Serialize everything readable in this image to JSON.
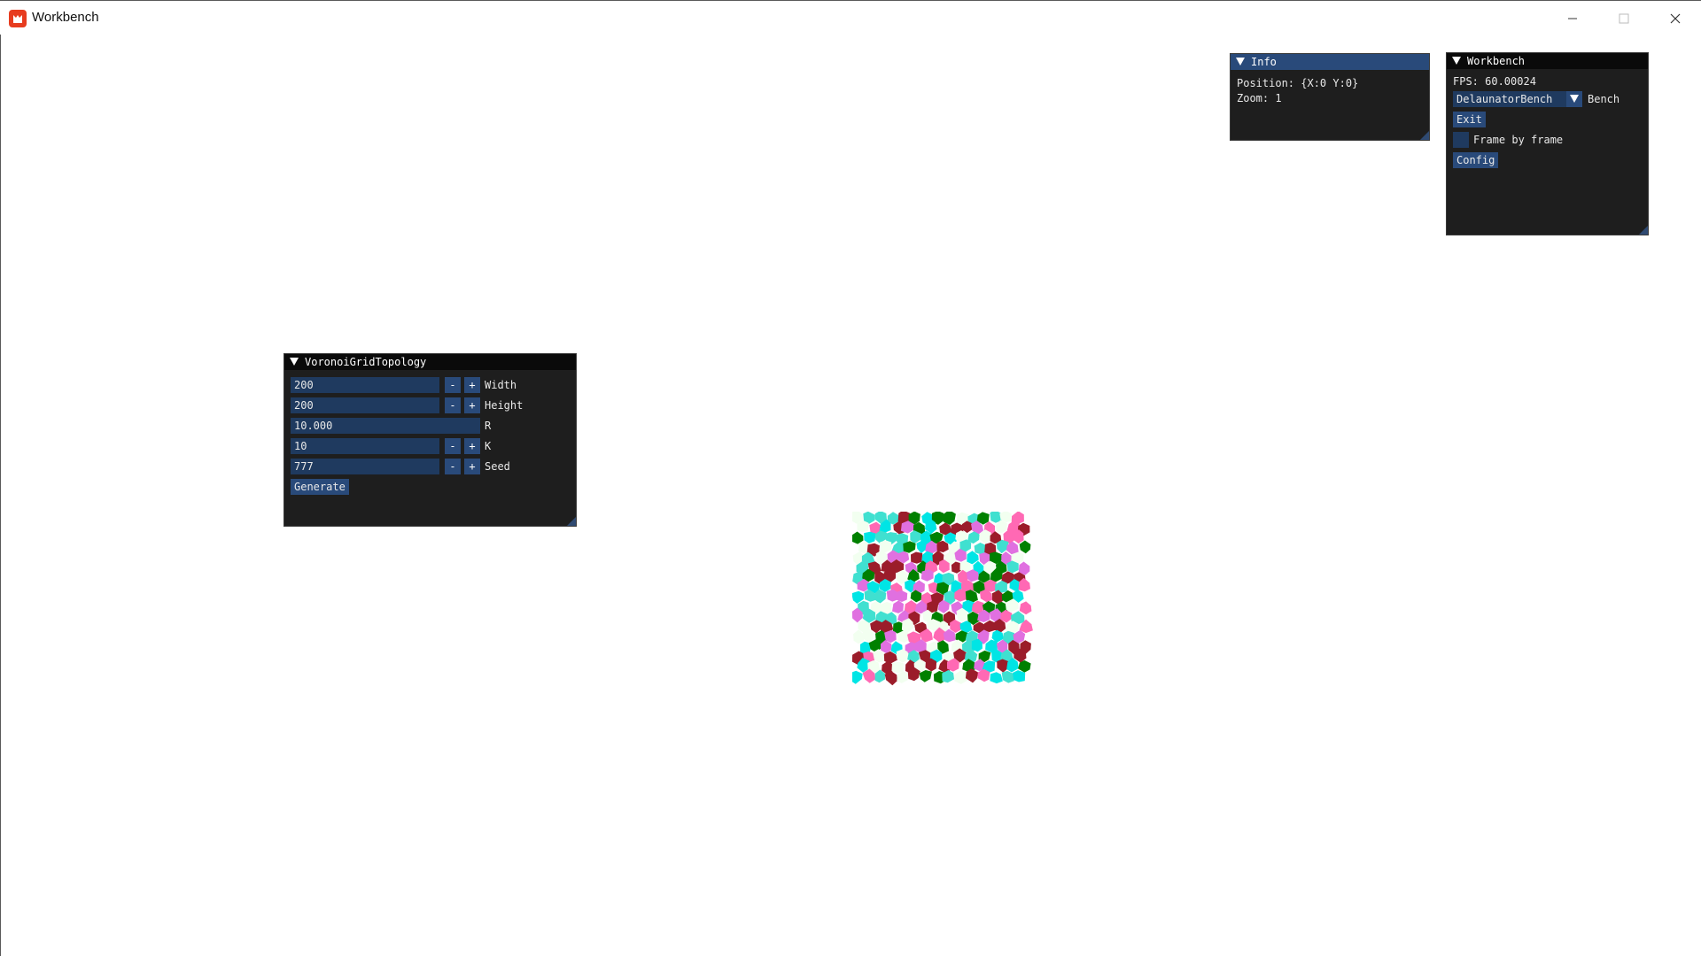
{
  "window": {
    "title": "Workbench",
    "controls": [
      "minimize-icon",
      "maximize-icon",
      "close-icon"
    ]
  },
  "colors": {
    "panel_bg": "#1e1e1e",
    "header_active": "#294a7a",
    "field_bg": "#1f3a5f",
    "button_bg": "#294a7a",
    "voronoi_palette": [
      "#008000",
      "#9b1c2a",
      "#ff69b4",
      "#e070e0",
      "#00e5e5",
      "#40e0d0",
      "#f2fff0"
    ]
  },
  "info_panel": {
    "title": "Info",
    "position_label": "Position: {X:0 Y:0}",
    "zoom_label": "Zoom: 1"
  },
  "workbench_panel": {
    "title": "Workbench",
    "fps_label": "FPS: 60.00024",
    "bench_select_value": "DelaunatorBench",
    "bench_label": "Bench",
    "exit_label": "Exit",
    "frame_by_frame_label": "Frame by frame",
    "frame_by_frame_checked": false,
    "config_label": "Config"
  },
  "voronoi_panel": {
    "title": "VoronoiGridTopology",
    "fields": [
      {
        "value": "200",
        "label": "Width",
        "stepper": true
      },
      {
        "value": "200",
        "label": "Height",
        "stepper": true
      },
      {
        "value": "10.000",
        "label": "R",
        "stepper": false
      },
      {
        "value": "10",
        "label": "K",
        "stepper": true
      },
      {
        "value": "777",
        "label": "Seed",
        "stepper": true
      }
    ],
    "minus_label": "-",
    "plus_label": "+",
    "generate_label": "Generate"
  }
}
